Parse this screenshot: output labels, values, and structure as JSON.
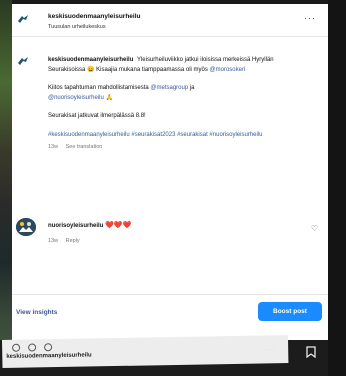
{
  "header": {
    "account_name": "keskisuodenmaanyleisurheilu",
    "subtitle": "Tuusulan urheilukeskus",
    "more_label": "···"
  },
  "caption": {
    "username": "keskisuodenmaanyleisurheilu",
    "intro": "Yleisurheiluviikko jatkui iloisissa merkeissä Hyryllän Seurakisoissa 😄 Kisaajia mukana tiamppaamassa oli myös",
    "intro_mention": "@morosokeri",
    "thanks": "Kiitos tapahtuman mahdollistamisesta",
    "thanks_mention_1": "@metsagroup",
    "thanks_and": "ja",
    "thanks_mention_2": "@nuorisoyleisurheilu",
    "thanks_emoji": "🙏",
    "next_events": "Seurakisat jatkuvat ilmerpälässä 8.8!",
    "hashtags": "#keskisuodenmaanyleisurheilu #seurakisat2023 #seurakisat #nuorisoyleisurheilu",
    "time": "13w",
    "see_translation": "See translation"
  },
  "comment": {
    "username": "nuorisoyleisurheilu",
    "hearts": "❤️❤️❤️",
    "time": "13w",
    "reply": "Reply"
  },
  "actions": {
    "view_insights": "View insights",
    "boost_post": "Boost post"
  },
  "bottom": {
    "account_name": "keskisuodenmaanyleisurheilu",
    "more_label": "···"
  }
}
